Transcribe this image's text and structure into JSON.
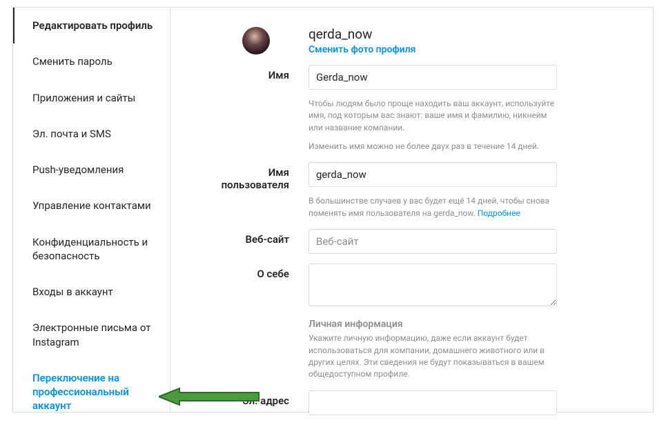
{
  "sidebar": {
    "items": [
      {
        "label": "Редактировать профиль"
      },
      {
        "label": "Сменить пароль"
      },
      {
        "label": "Приложения и сайты"
      },
      {
        "label": "Эл. почта и SMS"
      },
      {
        "label": "Push-уведомления"
      },
      {
        "label": "Управление контактами"
      },
      {
        "label": "Конфиденциальность и безопасность"
      },
      {
        "label": "Входы в аккаунт"
      },
      {
        "label": "Электронные письма от Instagram"
      },
      {
        "label": "Переключение на профессиональный аккаунт"
      }
    ]
  },
  "profile": {
    "username_display": "qerda_now",
    "change_photo": "Сменить фото профиля",
    "name_label": "Имя",
    "name_value": "Gerda_now",
    "name_help1": "Чтобы людям было проще находить ваш аккаунт, используйте имя, под которым вас знают: ваше имя и фамилию, никнейм или название компании.",
    "name_help2": "Изменить имя можно не более двух раз в течение 14 дней.",
    "username_label": "Имя пользователя",
    "username_value": "gerda_now",
    "username_help": "В большинстве случаев у вас будет ещё 14 дней, чтобы снова поменять имя пользователя на gerda_now. ",
    "more_link": "Подробнее",
    "website_label": "Веб-сайт",
    "website_placeholder": "Веб-сайт",
    "bio_label": "О себе",
    "personal_title": "Личная информация",
    "personal_help": "Укажите личную информацию, даже если аккаунт будет использоваться для компании, домашнего животного или в других целях. Эти сведения не будут показываться в вашем общедоступном профиле.",
    "email_label": "Эл. адрес"
  }
}
